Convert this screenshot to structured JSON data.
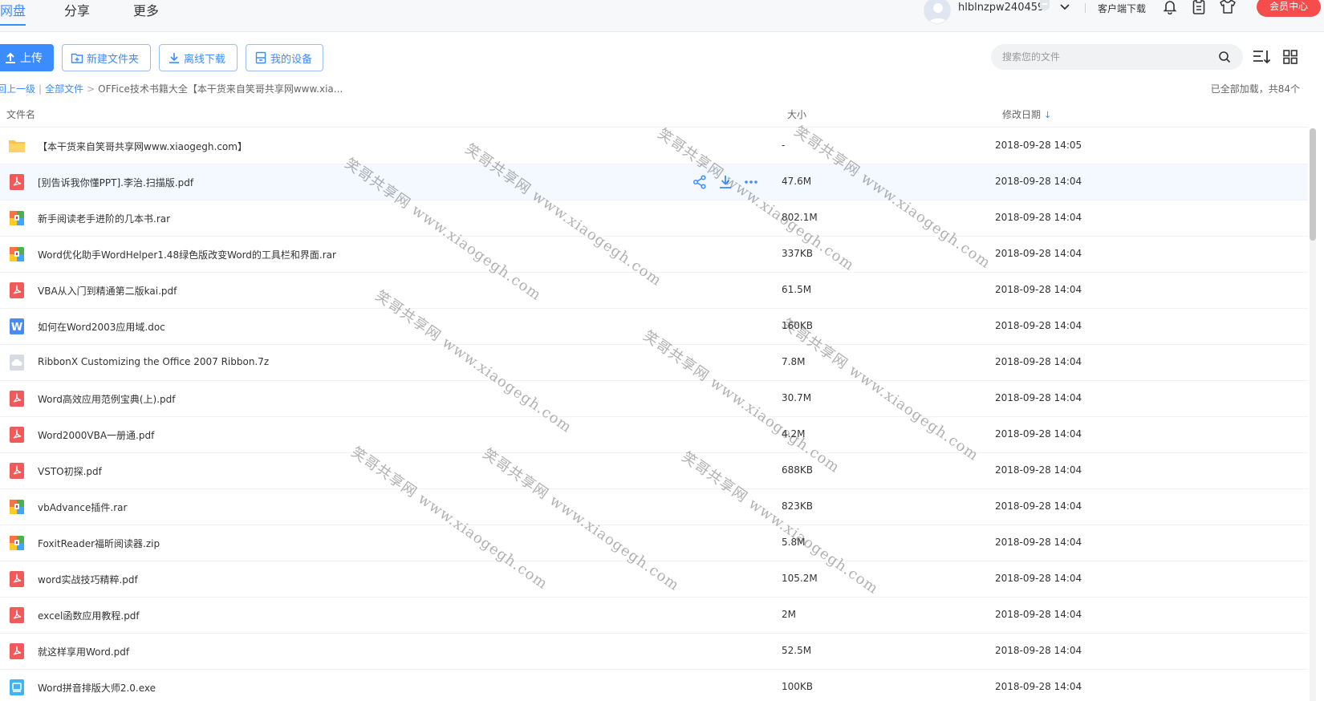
{
  "nav": {
    "tabs": [
      "网盘",
      "分享",
      "更多"
    ],
    "active_tab": "网盘",
    "username": "hlblnzpw240459",
    "client_download": "客户端下载",
    "vip_center": "会员中心"
  },
  "toolbar": {
    "upload": "上传",
    "new_folder": "新建文件夹",
    "offline_download": "离线下载",
    "my_devices": "我的设备",
    "search_placeholder": "搜索您的文件"
  },
  "breadcrumb": {
    "back": "返回上一级",
    "all_files": "全部文件",
    "separator": ">",
    "current": "OFFice技术书籍大全【本干货来自笑哥共享网www.xia..."
  },
  "load_status": "已全部加载，共84个",
  "columns": {
    "name": "文件名",
    "size": "大小",
    "date": "修改日期"
  },
  "files": [
    {
      "name": "【本干货来自笑哥共享网www.xiaogegh.com】",
      "size": "-",
      "date": "2018-09-28 14:05",
      "type": "folder-icon"
    },
    {
      "name": "[别告诉我你懂PPT].李治.扫描版.pdf",
      "size": "47.6M",
      "date": "2018-09-28 14:04",
      "type": "pdf-icon"
    },
    {
      "name": "新手阅读老手进阶的几本书.rar",
      "size": "802.1M",
      "date": "2018-09-28 14:04",
      "type": "archive-icon"
    },
    {
      "name": "Word优化助手WordHelper1.48绿色版改变Word的工具栏和界面.rar",
      "size": "337KB",
      "date": "2018-09-28 14:04",
      "type": "archive-icon"
    },
    {
      "name": "VBA从入门到精通第二版kai.pdf",
      "size": "61.5M",
      "date": "2018-09-28 14:04",
      "type": "pdf-icon"
    },
    {
      "name": "如何在Word2003应用域.doc",
      "size": "160KB",
      "date": "2018-09-28 14:04",
      "type": "word-icon"
    },
    {
      "name": "RibbonX Customizing the Office 2007 Ribbon.7z",
      "size": "7.8M",
      "date": "2018-09-28 14:04",
      "type": "unknown-file-icon"
    },
    {
      "name": "Word高效应用范例宝典(上).pdf",
      "size": "30.7M",
      "date": "2018-09-28 14:04",
      "type": "pdf-icon"
    },
    {
      "name": "Word2000VBA一册通.pdf",
      "size": "4.2M",
      "date": "2018-09-28 14:04",
      "type": "pdf-icon"
    },
    {
      "name": "VSTO初探.pdf",
      "size": "688KB",
      "date": "2018-09-28 14:04",
      "type": "pdf-icon"
    },
    {
      "name": "vbAdvance插件.rar",
      "size": "823KB",
      "date": "2018-09-28 14:04",
      "type": "archive-icon"
    },
    {
      "name": "FoxitReader福昕阅读器.zip",
      "size": "5.8M",
      "date": "2018-09-28 14:04",
      "type": "archive-icon"
    },
    {
      "name": "word实战技巧精粹.pdf",
      "size": "105.2M",
      "date": "2018-09-28 14:04",
      "type": "pdf-icon"
    },
    {
      "name": "excel函数应用教程.pdf",
      "size": "2M",
      "date": "2018-09-28 14:04",
      "type": "pdf-icon"
    },
    {
      "name": "就这样享用Word.pdf",
      "size": "52.5M",
      "date": "2018-09-28 14:04",
      "type": "pdf-icon"
    },
    {
      "name": "Word拼音排版大师2.0.exe",
      "size": "100KB",
      "date": "2018-09-28 14:04",
      "type": "exe-icon"
    }
  ],
  "hovered_row": 1,
  "watermark": "笑哥共享网 www.xiaogegh.com",
  "colors": {
    "accent": "#3b8cff",
    "vip": "#f74c4c",
    "pdf": "#f15a5a",
    "folder": "#ffc542",
    "word": "#4a8af4"
  }
}
